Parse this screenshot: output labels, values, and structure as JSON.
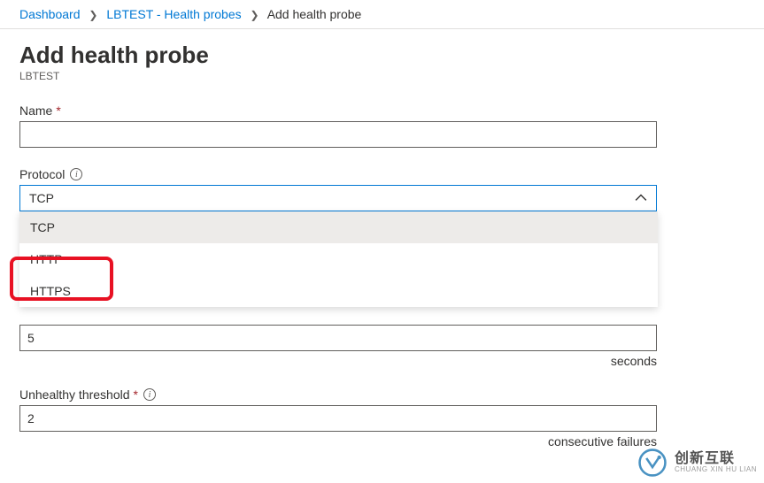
{
  "breadcrumb": {
    "items": [
      {
        "label": "Dashboard",
        "link": true
      },
      {
        "label": "LBTEST - Health probes",
        "link": true
      },
      {
        "label": "Add health probe",
        "link": false
      }
    ]
  },
  "page": {
    "title": "Add health probe",
    "subtitle": "LBTEST"
  },
  "fields": {
    "name": {
      "label": "Name",
      "value": ""
    },
    "protocol": {
      "label": "Protocol",
      "selected": "TCP",
      "options": [
        "TCP",
        "HTTP",
        "HTTPS"
      ]
    },
    "interval": {
      "value": "5",
      "suffix": "seconds"
    },
    "unhealthy_threshold": {
      "label": "Unhealthy threshold",
      "value": "2",
      "suffix": "consecutive failures"
    }
  },
  "watermark": {
    "main": "创新互联",
    "sub": "CHUANG XIN HU LIAN"
  }
}
